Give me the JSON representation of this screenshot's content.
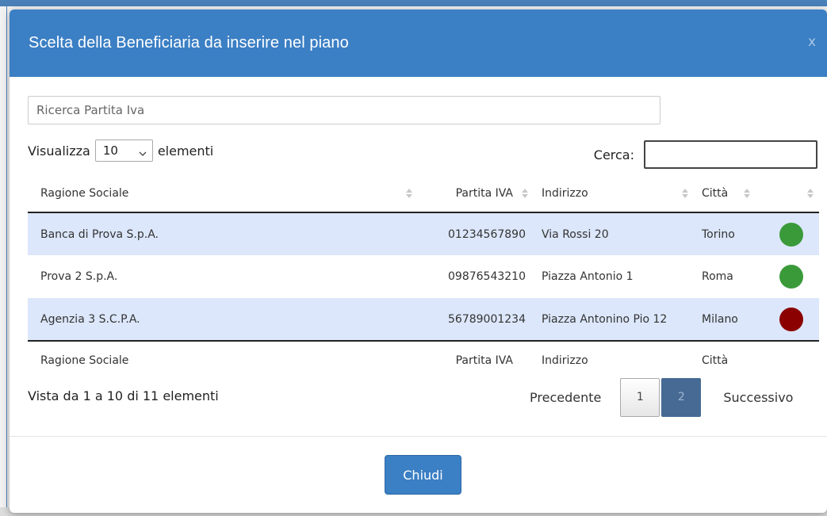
{
  "modal": {
    "title": "Scelta della Beneficiaria da inserire nel piano",
    "close_symbol": "x"
  },
  "piva_search": {
    "placeholder": "Ricerca Partita Iva",
    "value": ""
  },
  "length": {
    "prefix": "Visualizza",
    "value": "10",
    "suffix": "elementi"
  },
  "search": {
    "label": "Cerca:",
    "value": ""
  },
  "table": {
    "columns": [
      "Ragione Sociale",
      "Partita IVA",
      "Indirizzo",
      "Città",
      ""
    ],
    "rows": [
      {
        "name": "Banca di Prova S.p.A.",
        "piva": "01234567890",
        "address": "Via Rossi 20",
        "city": "Torino",
        "status_color": "#3a9a3a"
      },
      {
        "name": "Prova 2 S.p.A.",
        "piva": "09876543210",
        "address": "Piazza Antonio 1",
        "city": "Roma",
        "status_color": "#3a9a3a"
      },
      {
        "name": "Agenzia 3 S.C.P.A.",
        "piva": "56789001234",
        "address": "Piazza Antonino Pio 12",
        "city": "Milano",
        "status_color": "#8b0000"
      }
    ]
  },
  "info": "Vista da 1 a 10 di 11 elementi",
  "pager": {
    "previous": "Precedente",
    "pages": [
      "1",
      "2"
    ],
    "next": "Successivo"
  },
  "footer": {
    "close_label": "Chiudi"
  },
  "colors": {
    "header": "#3b7fc4",
    "row_highlight": "#dce7fb",
    "active_page": "#466a94"
  }
}
